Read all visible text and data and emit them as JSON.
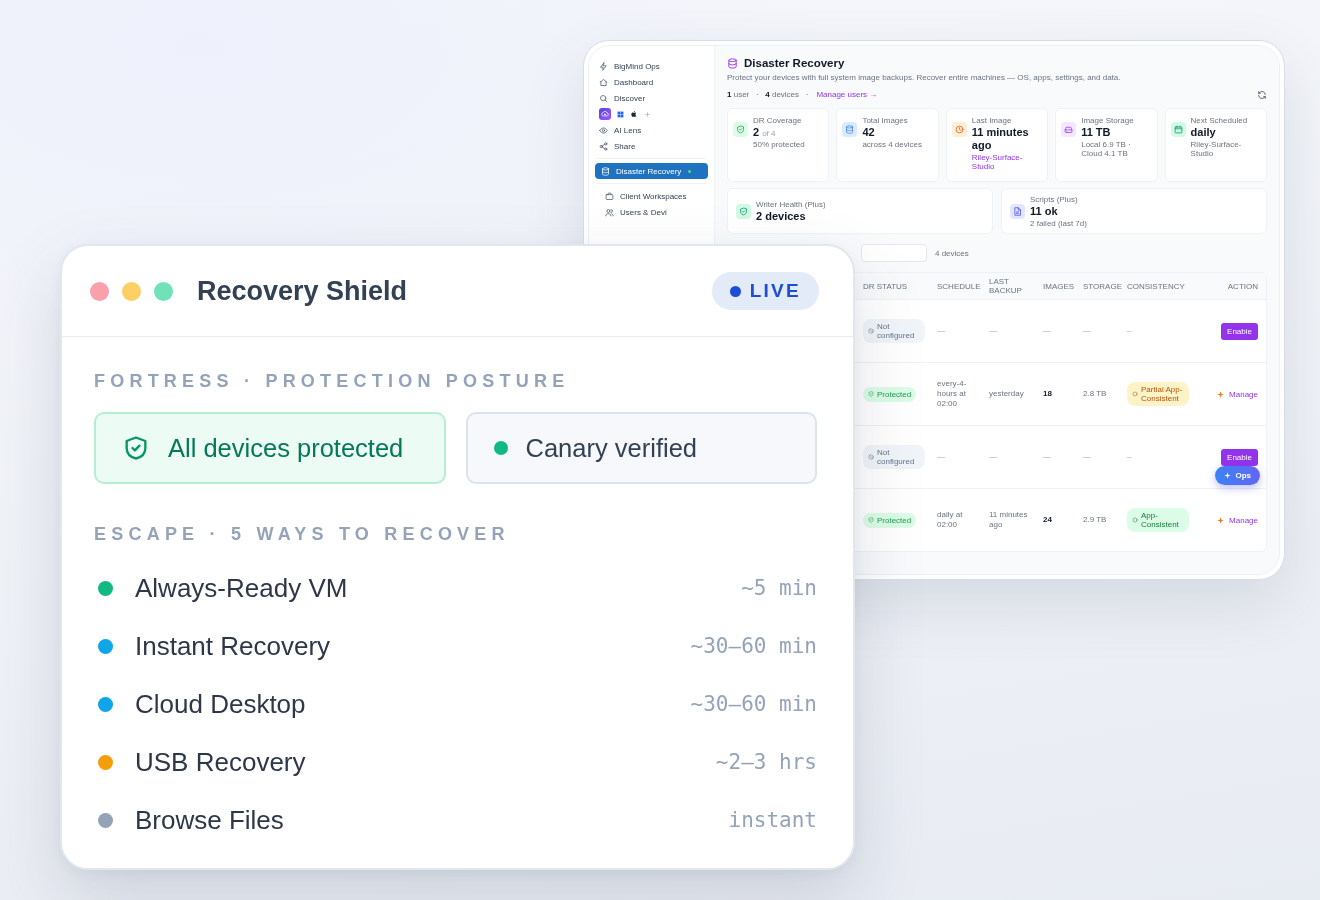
{
  "back_window": {
    "sidebar": {
      "groups": [
        {
          "items": [
            {
              "kind": "link",
              "label": "BigMind Ops",
              "selected": false,
              "indicator": false
            },
            {
              "kind": "link",
              "label": "Dashboard",
              "selected": false,
              "indicator": false
            },
            {
              "kind": "link",
              "label": "Discover",
              "selected": false,
              "indicator": false
            },
            {
              "kind": "platforms"
            },
            {
              "kind": "link",
              "label": "AI Lens",
              "selected": false,
              "indicator": false
            },
            {
              "kind": "link",
              "label": "Share",
              "selected": false,
              "indicator": false
            }
          ]
        },
        {
          "items": [
            {
              "kind": "link",
              "label": "Disaster Recovery",
              "selected": true,
              "indicator": true
            }
          ]
        },
        {
          "items": [
            {
              "kind": "link",
              "label": "Client Workspaces",
              "selected": false,
              "indicator": false
            },
            {
              "kind": "link",
              "label": "Users & Devi",
              "selected": false,
              "indicator": false
            }
          ]
        }
      ]
    },
    "header": {
      "title": "Disaster Recovery",
      "subtitle": "Protect your devices with full system image backups. Recover entire machines — OS, apps, settings, and data.",
      "meta": "**1** user   ·   **4** devices   ·",
      "manage_link": "Manage users →"
    },
    "stat_cards": [
      {
        "kind": "coverage",
        "label": "DR Coverage",
        "value": "2",
        "value_suffix": "of 4",
        "note": "50% protected",
        "note_link": false
      },
      {
        "kind": "images",
        "label": "Total Images",
        "value": "42",
        "note": "across 4 devices",
        "note_link": false
      },
      {
        "kind": "last_image",
        "label": "Last Image",
        "value": "11 minutes ago",
        "note": "Riley-Surface-Studio",
        "note_link": true
      },
      {
        "kind": "storage",
        "label": "Image Storage",
        "value": "11 TB",
        "note": "Local 6.9 TB · Cloud 4.1 TB",
        "note_link": false
      },
      {
        "kind": "schedule",
        "label": "Next Scheduled",
        "value": "daily",
        "note": "Riley-Surface-Studio",
        "note_link": false
      }
    ],
    "plus_cards": [
      {
        "kind": "writer",
        "label": "Writer Health (Plus)",
        "value": "2 devices"
      },
      {
        "kind": "scripts",
        "label": "Scripts (Plus)",
        "value": "11 ok",
        "note": "2 failed (last 7d)",
        "note_link": false
      }
    ],
    "toolbar": {
      "device_count": "4 devices"
    },
    "table": {
      "columns": [
        "DR STATUS",
        "SCHEDULE",
        "LAST BACKUP",
        "IMAGES",
        "STORAGE",
        "CONSISTENCY",
        "ACTION"
      ],
      "rows": [
        {
          "protected": false,
          "status": "Not configured",
          "schedule": "—",
          "last_backup": "—",
          "images": "—",
          "storage": "—",
          "consistency": {
            "kind": "none",
            "label": "–"
          },
          "action": {
            "kind": "enable",
            "label": "Enable"
          }
        },
        {
          "protected": true,
          "status": "Protected",
          "schedule": "every-4-hours at 02:00",
          "last_backup": "yesterday",
          "images": "18",
          "storage": "2.8 TB",
          "consistency": {
            "kind": "partial",
            "label": "Partial App-Consistent"
          },
          "action": {
            "kind": "manage",
            "label": "Manage"
          }
        },
        {
          "protected": false,
          "status": "Not configured",
          "schedule": "—",
          "last_backup": "—",
          "images": "—",
          "storage": "—",
          "consistency": {
            "kind": "none",
            "label": "–"
          },
          "action": {
            "kind": "enable",
            "label": "Enable"
          }
        },
        {
          "protected": true,
          "status": "Protected",
          "schedule": "daily at 02:00",
          "last_backup": "11 minutes ago",
          "images": "24",
          "storage": "2.9 TB",
          "consistency": {
            "kind": "full",
            "label": "App-Consistent"
          },
          "action": {
            "kind": "manage",
            "label": "Manage"
          }
        }
      ]
    },
    "ops_button": {
      "label": "Ops"
    }
  },
  "shield_card": {
    "title": "Recovery Shield",
    "badge": "LIVE",
    "posture": {
      "heading": "FORTRESS · PROTECTION POSTURE",
      "items": [
        {
          "kind": "highlight",
          "label": "All devices protected"
        },
        {
          "kind": "status",
          "label": "Canary verified"
        }
      ]
    },
    "recovery": {
      "heading": "ESCAPE · 5 WAYS TO RECOVER",
      "options": [
        {
          "name": "Always-Ready VM",
          "time": "~5 min",
          "color": "#10b981"
        },
        {
          "name": "Instant Recovery",
          "time": "~30–60 min",
          "color": "#0ea5e9"
        },
        {
          "name": "Cloud Desktop",
          "time": "~30–60 min",
          "color": "#0ea5e9"
        },
        {
          "name": "USB Recovery",
          "time": "~2–3 hrs",
          "color": "#f59e0b"
        },
        {
          "name": "Browse Files",
          "time": "instant",
          "color": "#94a3b8"
        }
      ]
    }
  }
}
